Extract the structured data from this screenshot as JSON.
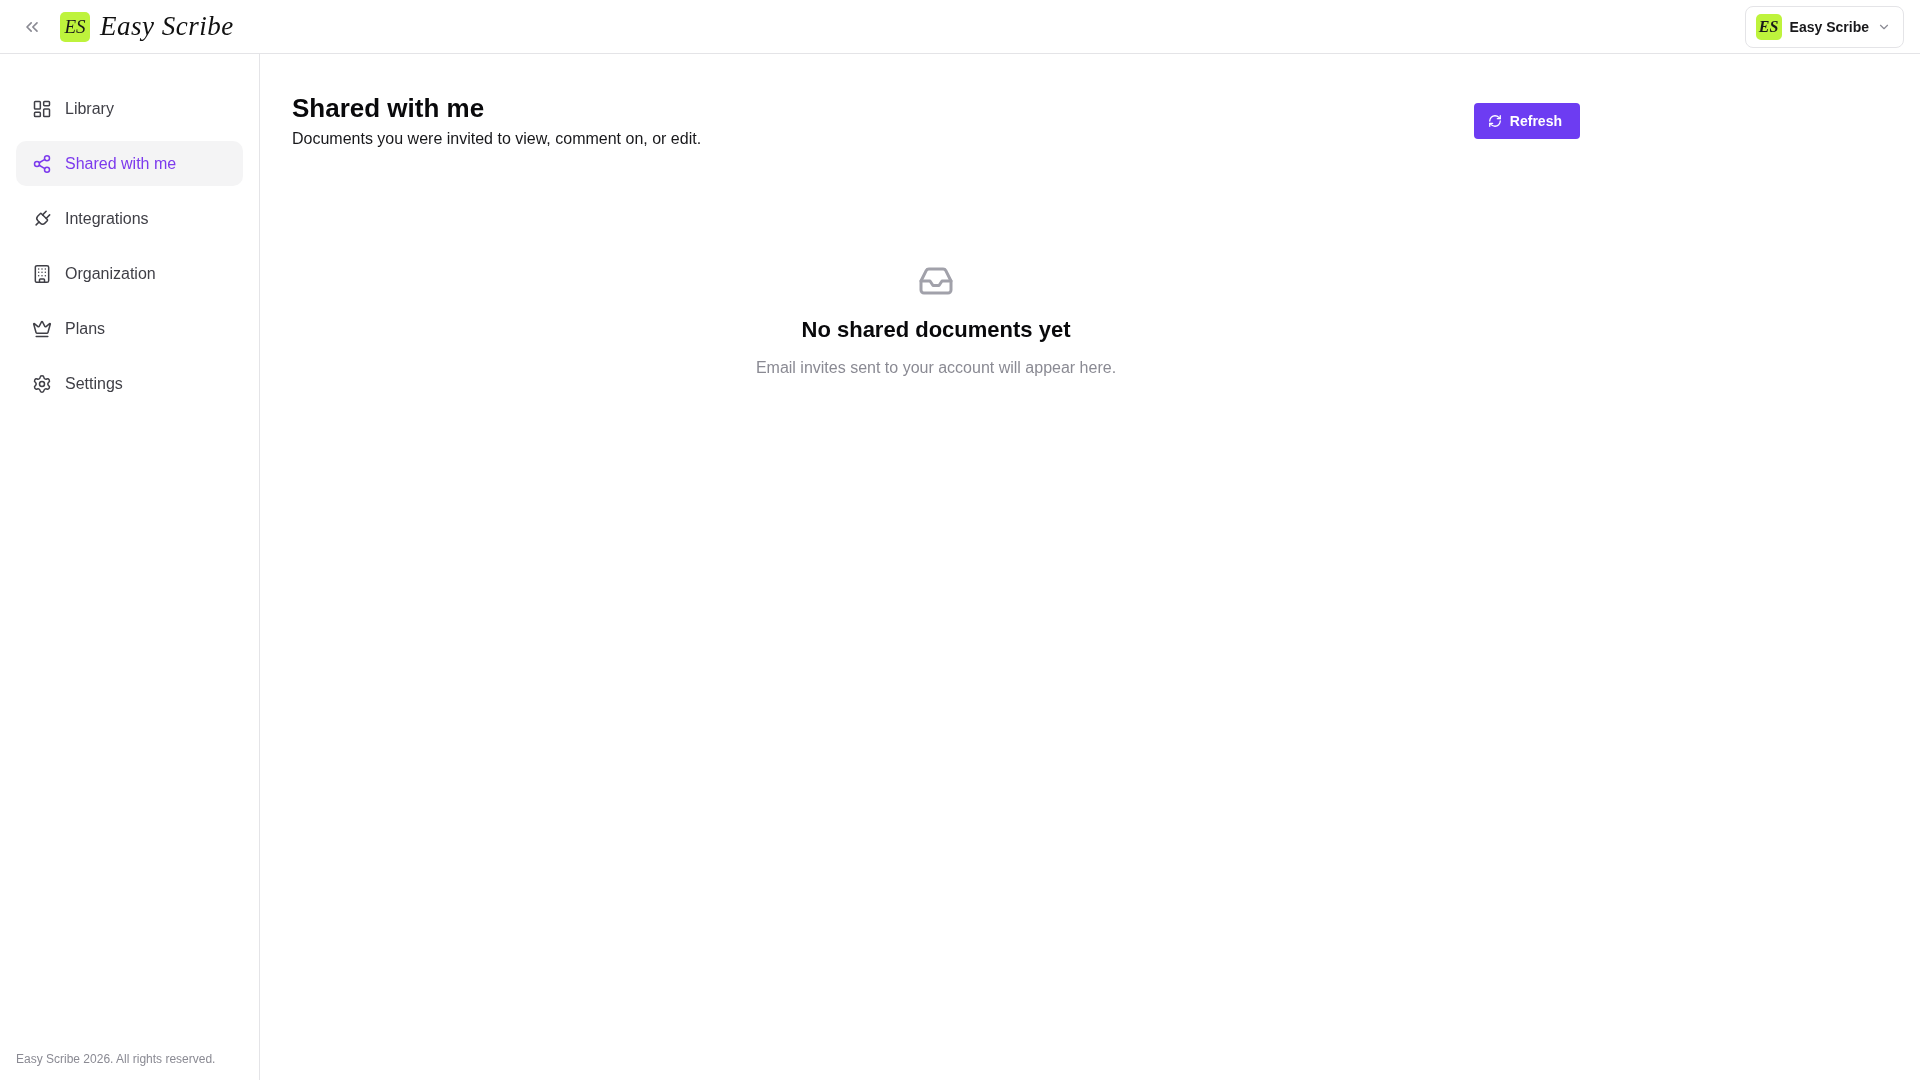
{
  "header": {
    "brand": {
      "logo_mark": "ES",
      "name": "Easy Scribe"
    },
    "account_menu": {
      "logo_mark": "ES",
      "name": "Easy Scribe"
    }
  },
  "sidebar": {
    "items": [
      {
        "label": "Library",
        "selected": false
      },
      {
        "label": "Shared with me",
        "selected": true
      },
      {
        "label": "Integrations",
        "selected": false
      },
      {
        "label": "Organization",
        "selected": false
      },
      {
        "label": "Plans",
        "selected": false
      },
      {
        "label": "Settings",
        "selected": false
      }
    ],
    "footer": "Easy Scribe 2026. All rights reserved."
  },
  "page": {
    "title": "Shared with me",
    "subtitle": "Documents you were invited to view, comment on, or edit.",
    "refresh_button": "Refresh"
  },
  "empty_state": {
    "title": "No shared documents yet",
    "message": "Email invites sent to your account will appear here."
  }
}
